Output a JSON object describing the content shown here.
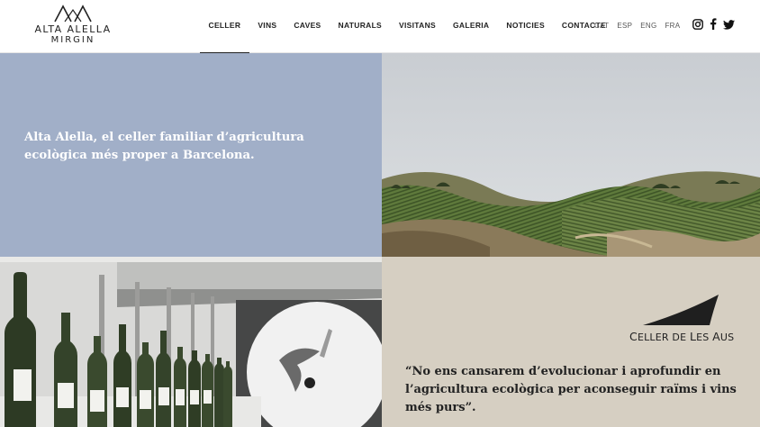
{
  "brand": {
    "logo_line1": "ALTA ALELLA",
    "logo_line2": "MIRGIN"
  },
  "nav": {
    "items": [
      {
        "label": "CELLER",
        "active": true
      },
      {
        "label": "VINS",
        "active": false
      },
      {
        "label": "CAVES",
        "active": false
      },
      {
        "label": "NATURALS",
        "active": false
      },
      {
        "label": "VISITANS",
        "active": false
      },
      {
        "label": "GALERIA",
        "active": false
      },
      {
        "label": "NOTICIES",
        "active": false
      },
      {
        "label": "CONTACTE",
        "active": false
      }
    ]
  },
  "languages": [
    "CAT",
    "ESP",
    "ENG",
    "FRA"
  ],
  "social": [
    "instagram-icon",
    "facebook-icon",
    "twitter-icon"
  ],
  "hero": {
    "headline": "Alta Alella, el celler familiar d’agricultura ecològica més proper a Barcelona."
  },
  "celler": {
    "name_first_c": "C",
    "name_rest1": "ELLER DE ",
    "name_l": "L",
    "name_rest2": "ES ",
    "name_a": "A",
    "name_rest3": "US",
    "quote": "“No ens cansarem d’evolucionar i aprofundir en l’agricultura ecològica per aconseguir raïms i vins més purs”."
  },
  "colors": {
    "hero_bg": "#a1afc8",
    "quote_bg": "#d6cfc2"
  }
}
